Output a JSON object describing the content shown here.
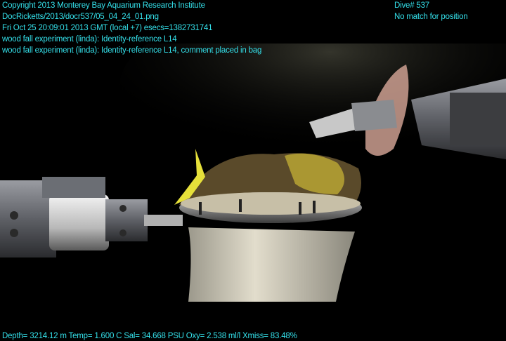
{
  "overlay": {
    "lines_left": [
      "Copyright 2013 Monterey Bay Aquarium Research Institute",
      "DocRicketts/2013/docr537/05_04_24_01.png",
      "Fri Oct 25 20:09:01 2013 GMT (local +7)  esecs=1382731741",
      "wood fall experiment (linda): Identity-reference L14",
      "wood fall experiment (linda): Identity-reference L14, comment placed in bag"
    ],
    "lines_right": [
      "Dive# 537",
      "No match for position"
    ],
    "bottom_line": "Depth= 3214.12 m  Temp= 1.600 C  Sal= 34.668 PSU  Oxy= 2.538 ml/l  Xmiss= 83.48%"
  },
  "colors": {
    "overlay_text": "#34e0ea",
    "background": "#000000",
    "manipulator_gray": "#6b6e74",
    "sample_bag": "#d8d3c2",
    "sediment_plume": "#2a2a24"
  }
}
